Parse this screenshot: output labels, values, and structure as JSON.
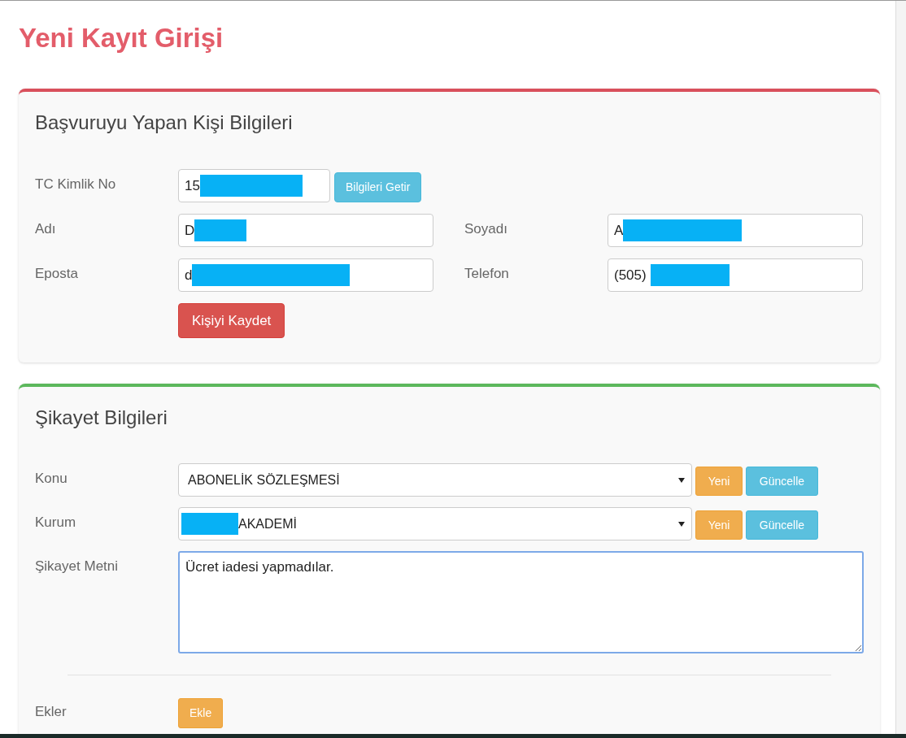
{
  "title": "Yeni Kayıt Girişi",
  "applicant_panel": {
    "heading": "Başvuruyu Yapan Kişi Bilgileri",
    "fields": [
      {
        "label": "TC Kimlik No",
        "value": "15",
        "redacted": true
      },
      {
        "label": "Adı",
        "value": "D",
        "redacted": true
      },
      {
        "label": "Soyadı",
        "value": "A",
        "redacted": true
      },
      {
        "label": "Eposta",
        "value": "d",
        "redacted": true
      },
      {
        "label": "Telefon",
        "value": "(505)",
        "redacted": true
      }
    ],
    "fetch_button": "Bilgileri Getir",
    "save_button": "Kişiyi Kaydet"
  },
  "complaint_panel": {
    "heading": "Şikayet Bilgileri",
    "selects": [
      {
        "label": "Konu",
        "value": "ABONELİK SÖZLEŞMESİ",
        "redacted": false,
        "new_button": "Yeni",
        "update_button": "Güncelle"
      },
      {
        "label": "Kurum",
        "value": "AKADEMİ",
        "redacted": true,
        "new_button": "Yeni",
        "update_button": "Güncelle"
      }
    ],
    "complaint_text": {
      "label": "Şikayet Metni",
      "value": "Ücret iadesi yapmadılar.",
      "focused": true
    },
    "attachments": {
      "label": "Ekler",
      "button": "Ekle"
    }
  }
}
